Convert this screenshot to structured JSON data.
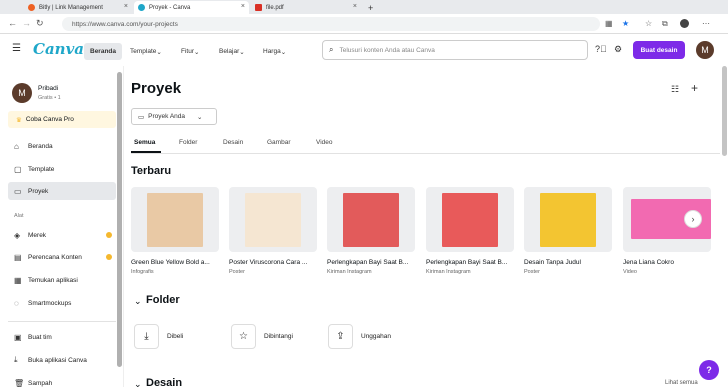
{
  "browser": {
    "tabs": [
      {
        "label": "Bitly | Link Management",
        "color": "#ee6123"
      },
      {
        "label": "Proyek - Canva",
        "color": "#1fa7c9"
      },
      {
        "label": "file.pdf",
        "color": "#d93025"
      }
    ],
    "url": "https://www.canva.com/your-projects"
  },
  "header": {
    "logo": "Canva",
    "nav": [
      "Beranda",
      "Template",
      "Fitur",
      "Belajar",
      "Harga"
    ],
    "search_placeholder": "Telusuri konten Anda atau Canva",
    "create_label": "Buat desain",
    "avatar": "M"
  },
  "sidebar": {
    "user_name": "Pribadi",
    "user_sub": "Gratis • 1",
    "pro_label": "Coba Canva Pro",
    "items": [
      {
        "label": "Beranda",
        "icon": "home-icon"
      },
      {
        "label": "Template",
        "icon": "template-icon"
      },
      {
        "label": "Proyek",
        "icon": "folder-icon"
      }
    ],
    "section_label": "Alat",
    "tools": [
      {
        "label": "Merek",
        "icon": "brand-icon"
      },
      {
        "label": "Perencana Konten",
        "icon": "calendar-icon"
      },
      {
        "label": "Temukan aplikasi",
        "icon": "apps-icon"
      },
      {
        "label": "Smartmockups",
        "icon": "mockup-icon"
      }
    ],
    "bottom": [
      {
        "label": "Buat tim",
        "icon": "team-icon"
      },
      {
        "label": "Buka aplikasi Canva",
        "icon": "download-icon"
      },
      {
        "label": "Sampah",
        "icon": "trash-icon"
      }
    ]
  },
  "main": {
    "title": "Proyek",
    "dropdown": "Proyek Anda",
    "filter_tabs": [
      "Semua",
      "Folder",
      "Desain",
      "Gambar",
      "Video"
    ],
    "recent_title": "Terbaru",
    "recent": [
      {
        "name": "Green Blue Yellow Bold a...",
        "type": "Infografis",
        "thumb": "#e9c9a5"
      },
      {
        "name": "Poster Viruscorona Cara ...",
        "type": "Poster",
        "thumb": "#f5e6d2"
      },
      {
        "name": "Perlengkapan Bayi Saat B...",
        "type": "Kiriman Instagram",
        "thumb": "#e25b5b"
      },
      {
        "name": "Perlengkapan Bayi Saat B...",
        "type": "Kiriman Instagram",
        "thumb": "#e85a5a"
      },
      {
        "name": "Desain Tanpa Judul",
        "type": "Poster",
        "thumb": "#f3c531"
      },
      {
        "name": "Jena Liana Cokro",
        "type": "Video",
        "thumb": "#f26ab1"
      }
    ],
    "folder_title": "Folder",
    "folders": [
      {
        "label": "Dibeli",
        "icon": "purchased-icon"
      },
      {
        "label": "Dibintangi",
        "icon": "star-icon"
      },
      {
        "label": "Unggahan",
        "icon": "upload-icon"
      }
    ],
    "design_title": "Desain",
    "see_all": "Lihat semua",
    "help": "?"
  }
}
